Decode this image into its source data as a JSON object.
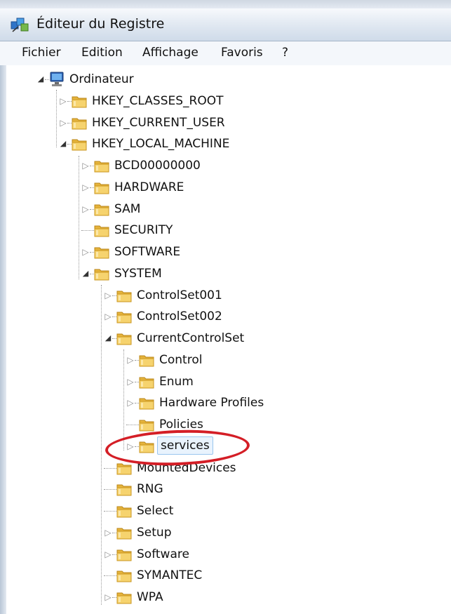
{
  "window": {
    "title": "Éditeur du Registre",
    "icon": "registry-editor-icon"
  },
  "menu": [
    {
      "label": "Fichier"
    },
    {
      "label": "Edition"
    },
    {
      "label": "Affichage"
    },
    {
      "label": "Favoris"
    },
    {
      "label": "?"
    }
  ],
  "tree": [
    {
      "label": "Ordinateur",
      "level": 0,
      "expander": "expanded",
      "icon": "computer-icon"
    },
    {
      "label": "HKEY_CLASSES_ROOT",
      "level": 1,
      "expander": "collapsed",
      "icon": "folder-icon"
    },
    {
      "label": "HKEY_CURRENT_USER",
      "level": 1,
      "expander": "collapsed",
      "icon": "folder-icon"
    },
    {
      "label": "HKEY_LOCAL_MACHINE",
      "level": 1,
      "expander": "expanded",
      "icon": "folder-icon"
    },
    {
      "label": "BCD00000000",
      "level": 2,
      "expander": "collapsed",
      "icon": "folder-icon"
    },
    {
      "label": "HARDWARE",
      "level": 2,
      "expander": "collapsed",
      "icon": "folder-icon"
    },
    {
      "label": "SAM",
      "level": 2,
      "expander": "collapsed",
      "icon": "folder-icon"
    },
    {
      "label": "SECURITY",
      "level": 2,
      "expander": "none",
      "icon": "folder-icon"
    },
    {
      "label": "SOFTWARE",
      "level": 2,
      "expander": "collapsed",
      "icon": "folder-icon"
    },
    {
      "label": "SYSTEM",
      "level": 2,
      "expander": "expanded",
      "icon": "folder-icon"
    },
    {
      "label": "ControlSet001",
      "level": 3,
      "expander": "collapsed",
      "icon": "folder-icon"
    },
    {
      "label": "ControlSet002",
      "level": 3,
      "expander": "collapsed",
      "icon": "folder-icon"
    },
    {
      "label": "CurrentControlSet",
      "level": 3,
      "expander": "expanded",
      "icon": "folder-icon"
    },
    {
      "label": "Control",
      "level": 4,
      "expander": "collapsed",
      "icon": "folder-icon"
    },
    {
      "label": "Enum",
      "level": 4,
      "expander": "collapsed",
      "icon": "folder-icon"
    },
    {
      "label": "Hardware Profiles",
      "level": 4,
      "expander": "collapsed",
      "icon": "folder-icon"
    },
    {
      "label": "Policies",
      "level": 4,
      "expander": "none",
      "icon": "folder-icon"
    },
    {
      "label": "services",
      "level": 4,
      "expander": "collapsed",
      "icon": "folder-icon",
      "selected": true
    },
    {
      "label": "MountedDevices",
      "level": 3,
      "expander": "none",
      "icon": "folder-icon"
    },
    {
      "label": "RNG",
      "level": 3,
      "expander": "none",
      "icon": "folder-icon"
    },
    {
      "label": "Select",
      "level": 3,
      "expander": "none",
      "icon": "folder-icon"
    },
    {
      "label": "Setup",
      "level": 3,
      "expander": "collapsed",
      "icon": "folder-icon"
    },
    {
      "label": "Software",
      "level": 3,
      "expander": "collapsed",
      "icon": "folder-icon"
    },
    {
      "label": "SYMANTEC",
      "level": 3,
      "expander": "none",
      "icon": "folder-icon"
    },
    {
      "label": "WPA",
      "level": 3,
      "expander": "collapsed",
      "icon": "folder-icon"
    }
  ],
  "colors": {
    "annotation": "#d41e26",
    "selection_bg": "#e9f3fd",
    "selection_border": "#99c5ee",
    "folder": "#e9b93a"
  }
}
